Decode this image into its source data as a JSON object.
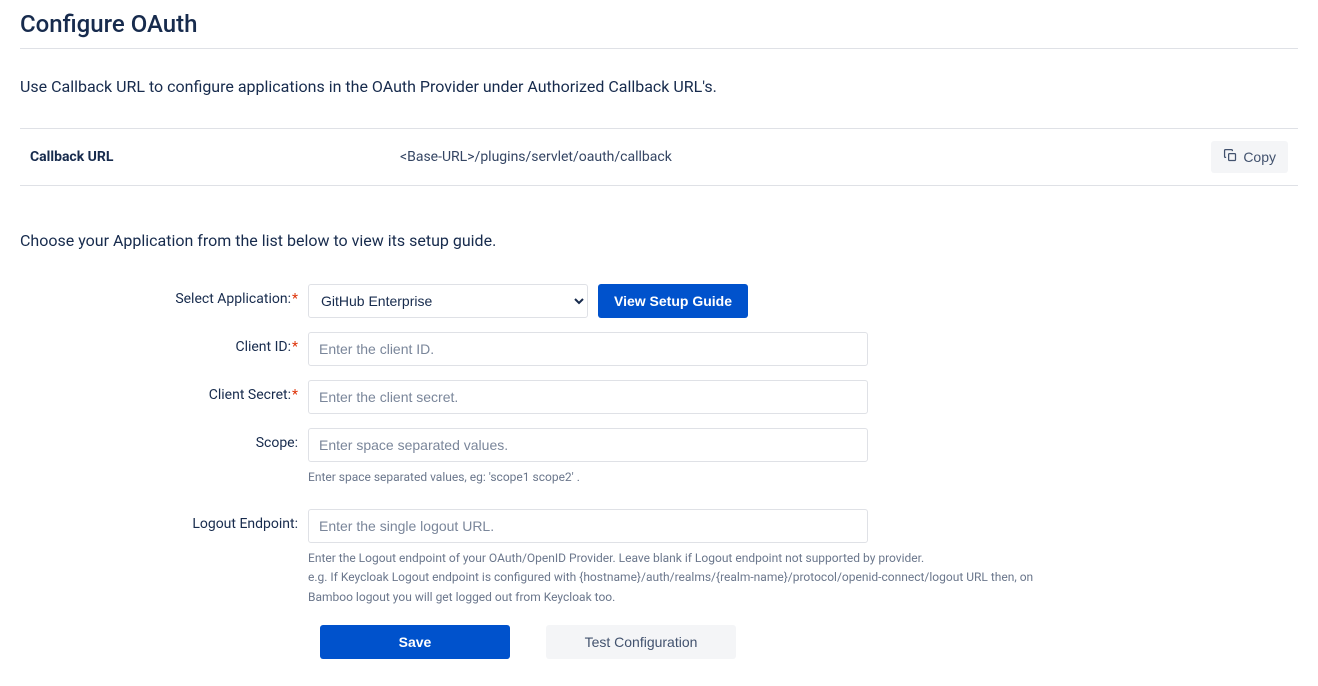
{
  "title": "Configure OAuth",
  "intro": "Use Callback URL to configure applications in the OAuth Provider under Authorized Callback URL's.",
  "callback": {
    "label": "Callback URL",
    "value": "<Base-URL>/plugins/servlet/oauth/callback",
    "copy_label": "Copy"
  },
  "choose_text": "Choose your Application from the list below to view its setup guide.",
  "form": {
    "select_app": {
      "label": "Select Application:",
      "value": "GitHub Enterprise",
      "view_guide": "View Setup Guide"
    },
    "client_id": {
      "label": "Client ID:",
      "placeholder": "Enter the client ID."
    },
    "client_secret": {
      "label": "Client Secret:",
      "placeholder": "Enter the client secret."
    },
    "scope": {
      "label": "Scope:",
      "placeholder": "Enter space separated values.",
      "help": "Enter space separated values, eg: 'scope1 scope2' ."
    },
    "logout_endpoint": {
      "label": "Logout Endpoint:",
      "placeholder": "Enter the single logout URL.",
      "help1": "Enter the Logout endpoint of your OAuth/OpenID Provider. Leave blank if Logout endpoint not supported by provider.",
      "help2": "e.g. If Keycloak Logout endpoint is configured with {hostname}/auth/realms/{realm-name}/protocol/openid-connect/logout URL then, on Bamboo logout you will get logged out from Keycloak too."
    },
    "save": "Save",
    "test": "Test Configuration"
  }
}
